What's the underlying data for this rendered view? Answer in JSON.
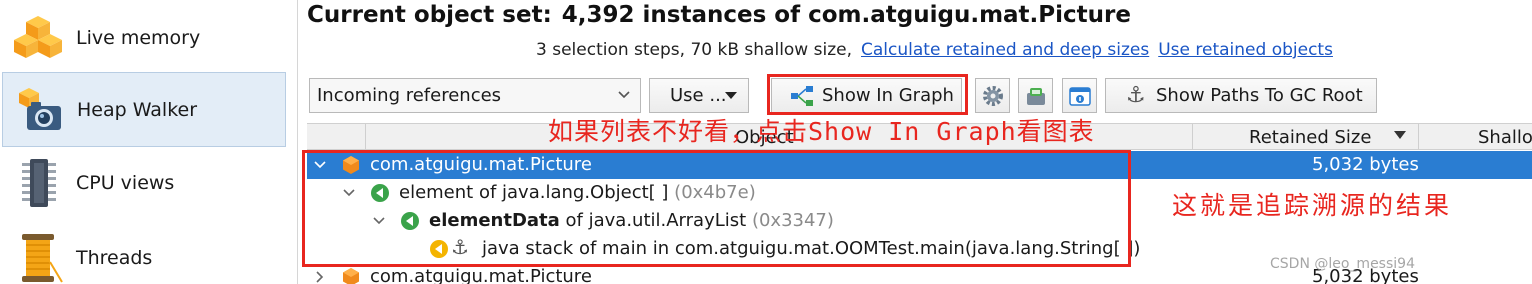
{
  "sidebar": {
    "items": [
      {
        "label": "Live memory",
        "icon": "live-memory-icon"
      },
      {
        "label": "Heap Walker",
        "icon": "heap-walker-icon",
        "active": true
      },
      {
        "label": "CPU views",
        "icon": "cpu-chip-icon"
      },
      {
        "label": "Threads",
        "icon": "threads-spool-icon"
      }
    ]
  },
  "header": {
    "title_prefix": "Current object set:",
    "title_count": "4,392 instances of com.atguigu.mat.Picture",
    "summary": "3 selection steps, 70 kB shallow size,",
    "link_retained": "Calculate retained and deep sizes",
    "link_use_retained": "Use retained objects"
  },
  "toolbar": {
    "view_select": "Incoming references",
    "use_button": "Use ...",
    "graph_button": "Show In Graph",
    "paths_button": "Show Paths To GC Root"
  },
  "table": {
    "columns": {
      "object": "Object",
      "retained": "Retained Size",
      "shallow": "Shallo"
    },
    "rows": [
      {
        "text": "com.atguigu.mat.Picture",
        "bytes": "5,032 bytes"
      },
      {
        "bold": "",
        "text": "element of java.lang.Object[ ]",
        "id": "(0x4b7e)"
      },
      {
        "bold": "elementData",
        "text": "of java.util.ArrayList",
        "id": "(0x3347)"
      },
      {
        "text": "java stack of main in com.atguigu.mat.OOMTest.main(java.lang.String[ ])"
      },
      {
        "text": "com.atguigu.mat.Picture",
        "bytes": "5,032 bytes"
      }
    ]
  },
  "annotations": {
    "note_graph": "如果列表不好看，点击Show In Graph看图表",
    "note_result": "这就是追踪溯源的结果"
  },
  "watermark": "CSDN @leo_messi94",
  "colors": {
    "selection": "#2a7dd2",
    "highlight_red": "#e8261f",
    "link": "#1a55c5"
  }
}
